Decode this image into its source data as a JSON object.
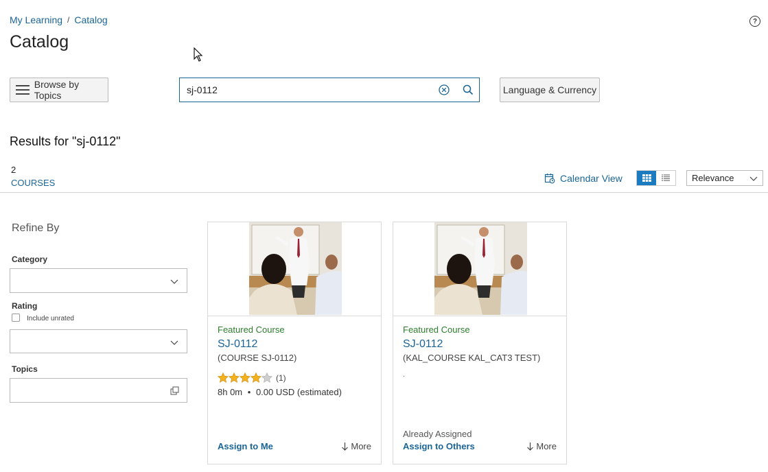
{
  "breadcrumb": {
    "items": [
      "My Learning",
      "Catalog"
    ],
    "separator": "/"
  },
  "help_icon": "question-circle-icon",
  "page": {
    "title": "Catalog"
  },
  "toolbar": {
    "browse_label": "Browse by Topics",
    "search_value": "sj-0112",
    "language_label": "Language & Currency"
  },
  "results": {
    "title": "Results for \"sj-0112\"",
    "count": "2",
    "count_label": "COURSES"
  },
  "view": {
    "calendar_label": "Calendar View",
    "active_view": "grid",
    "sort_value": "Relevance"
  },
  "refine": {
    "title": "Refine By",
    "category_label": "Category",
    "category_value": "",
    "rating_label": "Rating",
    "include_unrated": "Include unrated",
    "include_unrated_checked": false,
    "rating_value": "",
    "topics_label": "Topics",
    "topics_value": ""
  },
  "cards": [
    {
      "featured": "Featured Course",
      "title": "SJ-0112",
      "code": "(COURSE SJ-0112)",
      "rating": 4,
      "rating_count": "(1)",
      "duration": "8h 0m",
      "price": "0.00 USD (estimated)",
      "status": "",
      "action": "Assign to Me",
      "more": "More"
    },
    {
      "featured": "Featured Course",
      "title": "SJ-0112",
      "code": "(KAL_COURSE KAL_CAT3 TEST)",
      "note": ".",
      "status": "Already Assigned",
      "action": "Assign to Others",
      "more": "More"
    }
  ],
  "colors": {
    "link": "#1a6496",
    "featured": "#2d7d2d",
    "active_toggle": "#1a7bc1"
  }
}
